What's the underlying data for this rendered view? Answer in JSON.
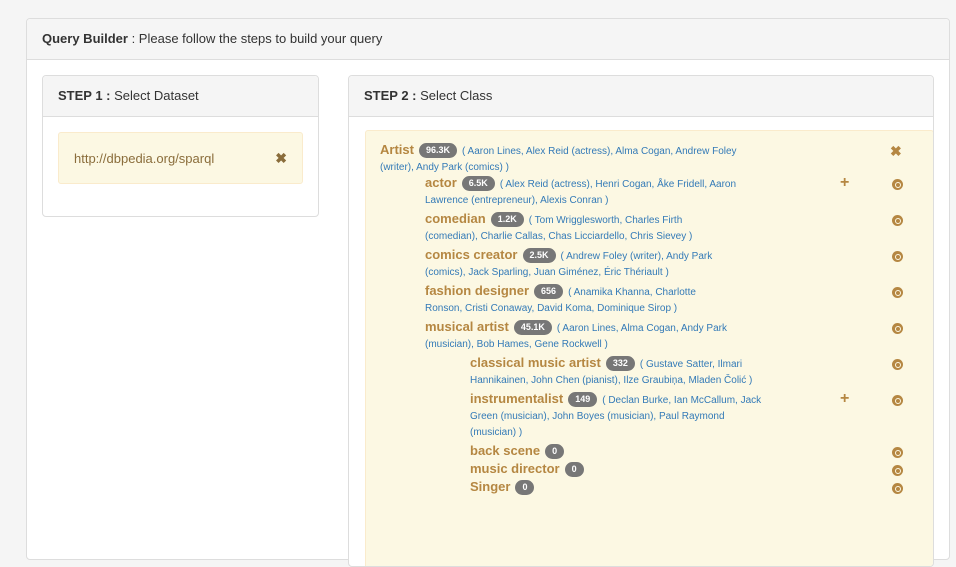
{
  "header": {
    "title_bold": "Query Builder",
    "title_rest": " : Please follow the steps to build your query"
  },
  "step1": {
    "label_bold": "STEP 1 :",
    "label_rest": " Select Dataset",
    "dataset": "http://dbpedia.org/sparql",
    "remove": "✖"
  },
  "step2": {
    "label_bold": "STEP 2 :",
    "label_rest": " Select Class",
    "root": {
      "name": "Artist",
      "count": "96.3K",
      "line1": "( Aaron Lines, Alex Reid (actress), Alma Cogan, Andrew Foley",
      "line2": "(writer), Andy Park (comics) )"
    },
    "classes": [
      {
        "name": "actor",
        "count": "6.5K",
        "line1": "( Alex Reid (actress), Henri Cogan, Åke Fridell, Aaron",
        "line2": "Lawrence (entrepreneur), Alexis Conran )"
      },
      {
        "name": "comedian",
        "count": "1.2K",
        "line1": "( Tom Wrigglesworth, Charles Firth",
        "line2": "(comedian), Charlie Callas, Chas Licciardello, Chris Sievey )"
      },
      {
        "name": "comics creator",
        "count": "2.5K",
        "line1": "( Andrew Foley (writer), Andy Park",
        "line2": "(comics), Jack Sparling, Juan Giménez, Éric Thériault )"
      },
      {
        "name": "fashion designer",
        "count": "656",
        "line1": "( Anamika Khanna, Charlotte",
        "line2": "Ronson, Cristi Conaway, David Koma, Dominique Sirop )"
      },
      {
        "name": "musical artist",
        "count": "45.1K",
        "line1": "( Aaron Lines, Alma Cogan, Andy Park",
        "line2": "(musician), Bob Hames, Gene Rockwell )"
      }
    ],
    "subclasses": [
      {
        "name": "classical music artist",
        "count": "332",
        "line1": "( Gustave Satter, Ilmari",
        "line2": "Hannikainen, John Chen (pianist), Ilze Graubiņa, Mladen Čolić )"
      },
      {
        "name": "instrumentalist",
        "count": "149",
        "line1": "( Declan Burke, Ian McCallum, Jack",
        "line2": "Green (musician), John Boyes (musician), Paul Raymond",
        "line3": "(musician) )"
      },
      {
        "name": "back scene",
        "count": "0"
      },
      {
        "name": "music director",
        "count": "0"
      },
      {
        "name": "Singer",
        "count": "0"
      }
    ],
    "expand": "+",
    "remove": "✖"
  }
}
